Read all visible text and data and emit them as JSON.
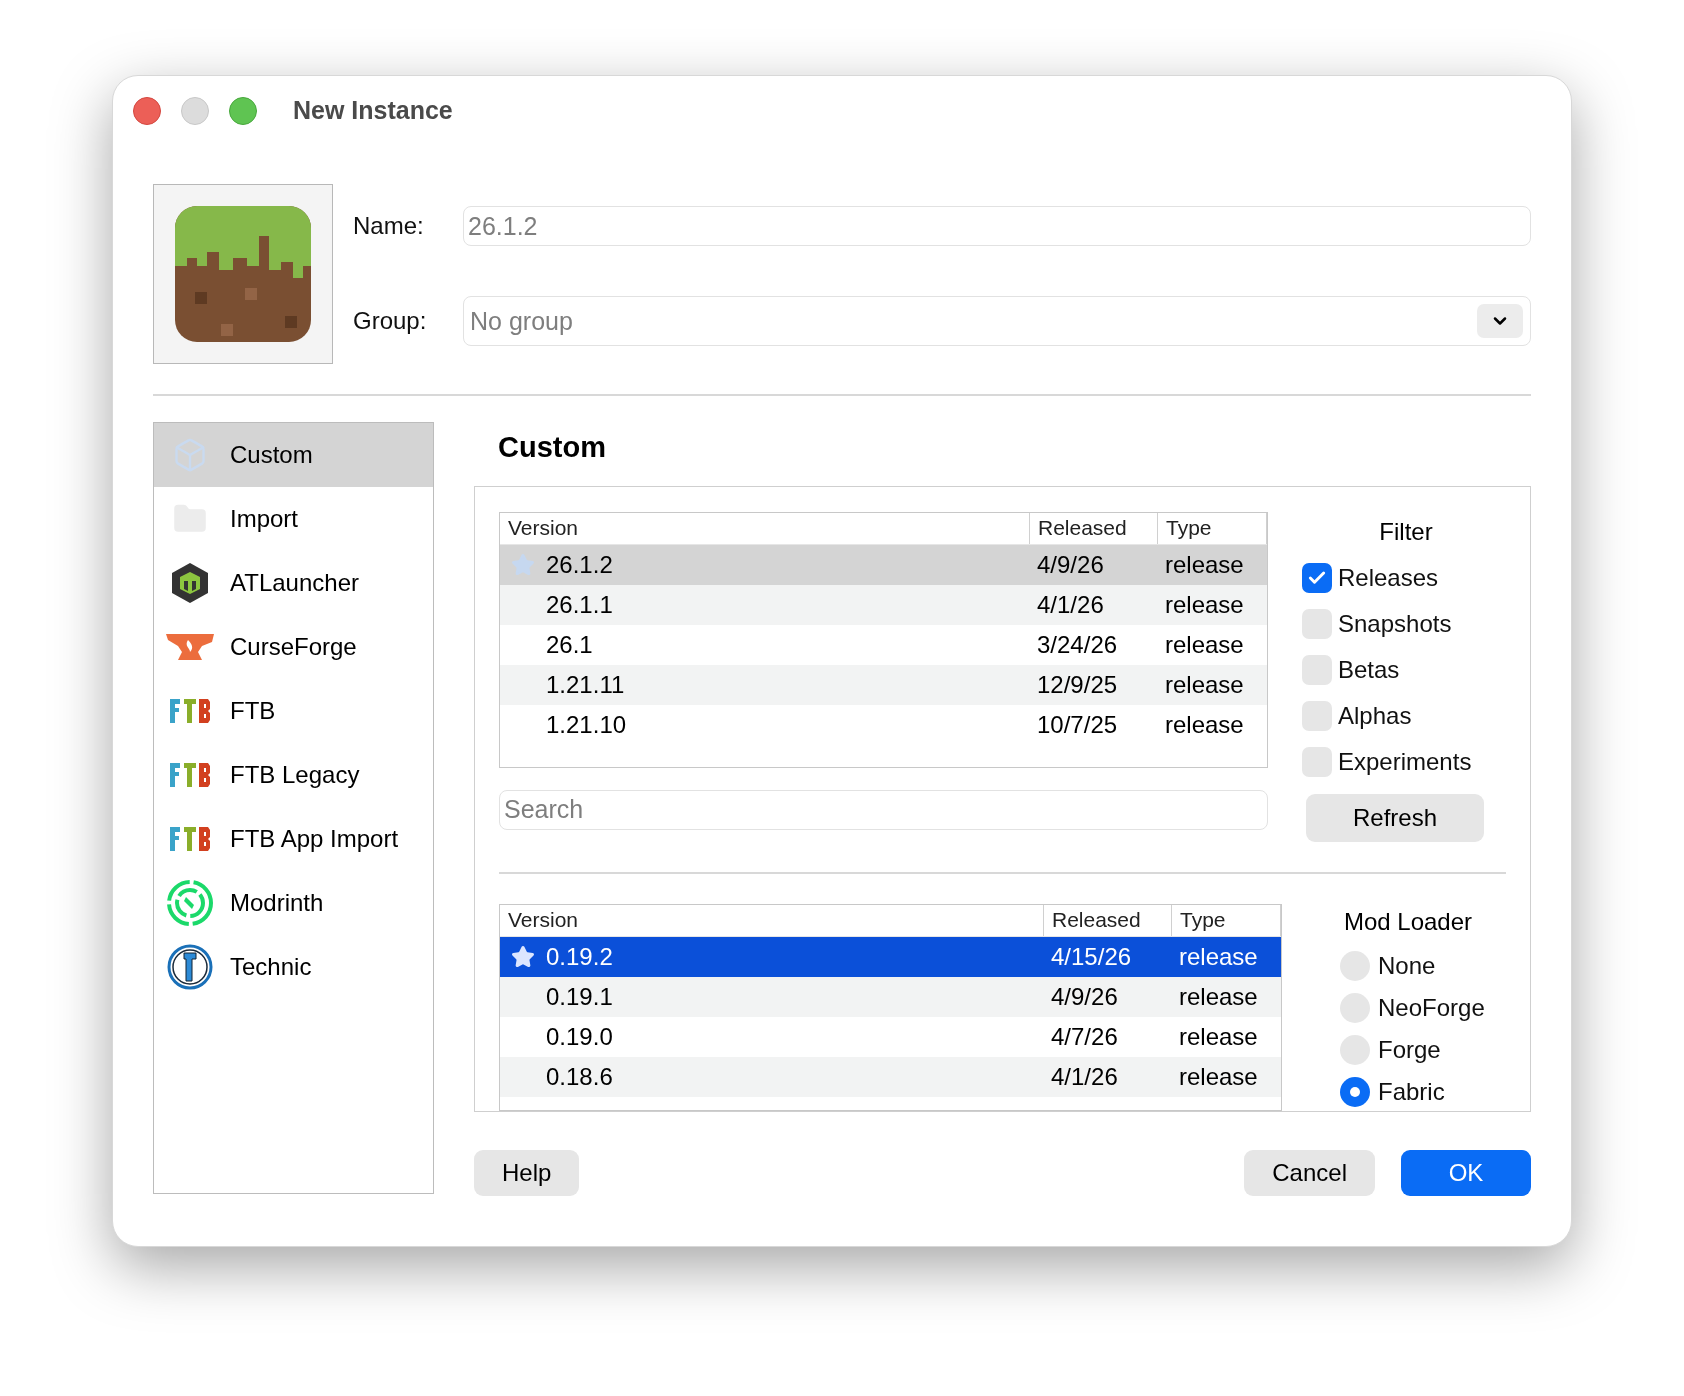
{
  "window": {
    "title": "New Instance"
  },
  "instance": {
    "name_label": "Name:",
    "name_placeholder": "26.1.2",
    "group_label": "Group:",
    "group_placeholder": "No group"
  },
  "sidebar": {
    "items": [
      {
        "label": "Custom",
        "selected": true
      },
      {
        "label": "Import",
        "selected": false
      },
      {
        "label": "ATLauncher",
        "selected": false
      },
      {
        "label": "CurseForge",
        "selected": false
      },
      {
        "label": "FTB",
        "selected": false
      },
      {
        "label": "FTB Legacy",
        "selected": false
      },
      {
        "label": "FTB App Import",
        "selected": false
      },
      {
        "label": "Modrinth",
        "selected": false
      },
      {
        "label": "Technic",
        "selected": false
      }
    ]
  },
  "page_title": "Custom",
  "version_table": {
    "focused": false,
    "columns": [
      "Version",
      "Released",
      "Type"
    ],
    "rows": [
      {
        "version": "26.1.2",
        "released": "4/9/26",
        "type": "release",
        "selected": true,
        "recommended": true
      },
      {
        "version": "26.1.1",
        "released": "4/1/26",
        "type": "release",
        "selected": false,
        "recommended": false
      },
      {
        "version": "26.1",
        "released": "3/24/26",
        "type": "release",
        "selected": false,
        "recommended": false
      },
      {
        "version": "1.21.11",
        "released": "12/9/25",
        "type": "release",
        "selected": false,
        "recommended": false
      },
      {
        "version": "1.21.10",
        "released": "10/7/25",
        "type": "release",
        "selected": false,
        "recommended": false
      }
    ]
  },
  "filter": {
    "title": "Filter",
    "options": [
      {
        "label": "Releases",
        "checked": true
      },
      {
        "label": "Snapshots",
        "checked": false
      },
      {
        "label": "Betas",
        "checked": false
      },
      {
        "label": "Alphas",
        "checked": false
      },
      {
        "label": "Experiments",
        "checked": false
      }
    ]
  },
  "search": {
    "placeholder": "Search"
  },
  "refresh_button": "Refresh",
  "loader_table": {
    "focused": true,
    "columns": [
      "Version",
      "Released",
      "Type"
    ],
    "rows": [
      {
        "version": "0.19.2",
        "released": "4/15/26",
        "type": "release",
        "selected": true,
        "recommended": true
      },
      {
        "version": "0.19.1",
        "released": "4/9/26",
        "type": "release",
        "selected": false,
        "recommended": false
      },
      {
        "version": "0.19.0",
        "released": "4/7/26",
        "type": "release",
        "selected": false,
        "recommended": false
      },
      {
        "version": "0.18.6",
        "released": "4/1/26",
        "type": "release",
        "selected": false,
        "recommended": false
      }
    ]
  },
  "mod_loader": {
    "title": "Mod Loader",
    "options": [
      {
        "label": "None",
        "selected": false
      },
      {
        "label": "NeoForge",
        "selected": false
      },
      {
        "label": "Forge",
        "selected": false
      },
      {
        "label": "Fabric",
        "selected": true
      }
    ]
  },
  "help_button": "Help",
  "buttons": [
    {
      "label": "Cancel",
      "default": false
    },
    {
      "label": "OK",
      "default": true
    }
  ]
}
